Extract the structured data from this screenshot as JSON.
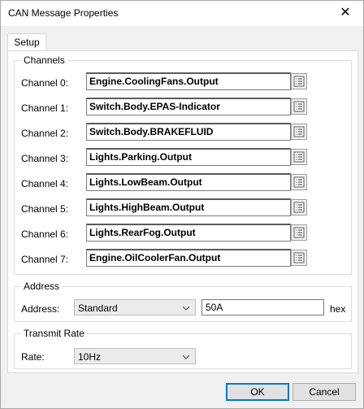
{
  "window": {
    "title": "CAN Message Properties",
    "close_glyph": "✕"
  },
  "tabs": [
    {
      "label": "Setup"
    }
  ],
  "channels_group": {
    "legend": "Channels",
    "items": [
      {
        "label": "Channel 0:",
        "value": "Engine.CoolingFans.Output"
      },
      {
        "label": "Channel 1:",
        "value": "Switch.Body.EPAS-Indicator"
      },
      {
        "label": "Channel 2:",
        "value": "Switch.Body.BRAKEFLUID"
      },
      {
        "label": "Channel 3:",
        "value": "Lights.Parking.Output"
      },
      {
        "label": "Channel 4:",
        "value": "Lights.LowBeam.Output"
      },
      {
        "label": "Channel 5:",
        "value": "Lights.HighBeam.Output"
      },
      {
        "label": "Channel 6:",
        "value": "Lights.RearFog.Output"
      },
      {
        "label": "Channel 7:",
        "value": "Engine.OilCoolerFan.Output"
      }
    ]
  },
  "address_group": {
    "legend": "Address",
    "label": "Address:",
    "type_value": "Standard",
    "value": "50A",
    "unit": "hex"
  },
  "rate_group": {
    "legend": "Transmit Rate",
    "label": "Rate:",
    "value": "10Hz"
  },
  "buttons": {
    "ok": "OK",
    "cancel": "Cancel"
  },
  "icons": {
    "browse": "list-browse-icon",
    "dropdown": "chevron-down-icon",
    "close": "close-icon"
  }
}
